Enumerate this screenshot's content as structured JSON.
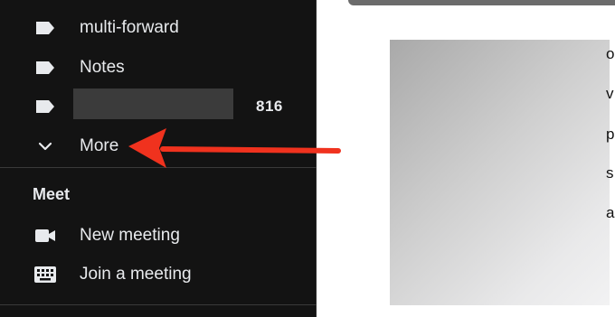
{
  "sidebar": {
    "labels": [
      {
        "label": "multi-forward",
        "icon": "label-icon"
      },
      {
        "label": "Notes",
        "icon": "label-icon"
      },
      {
        "label": "",
        "icon": "label-icon",
        "count": "816"
      }
    ],
    "more": {
      "label": "More",
      "icon": "chevron-down-icon"
    },
    "meet": {
      "title": "Meet",
      "items": [
        {
          "label": "New meeting",
          "icon": "videocam-icon"
        },
        {
          "label": "Join a meeting",
          "icon": "keyboard-icon"
        }
      ]
    }
  },
  "content": {
    "edge_letters": [
      "o",
      "v",
      "p",
      "s",
      "a"
    ]
  },
  "annotation": {
    "arrow_color": "#f0321e"
  }
}
